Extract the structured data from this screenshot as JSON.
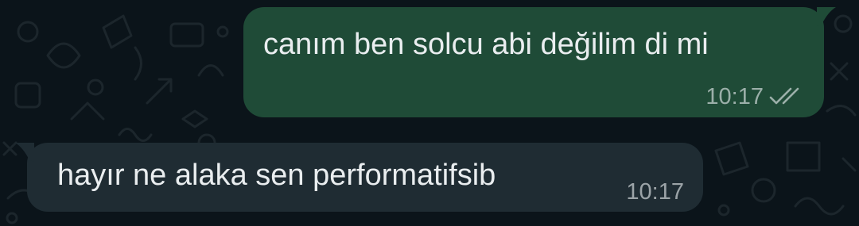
{
  "chat": {
    "background_color": "#0b141a",
    "messages": [
      {
        "direction": "outgoing",
        "text": "canım ben solcu abi değilim di mi",
        "time": "10:17",
        "status_icon": "double-check-icon",
        "bubble_color": "#1f4b37"
      },
      {
        "direction": "incoming",
        "text": "hayır ne alaka sen performatifsib",
        "time": "10:17",
        "bubble_color": "#1f2c33"
      }
    ]
  }
}
